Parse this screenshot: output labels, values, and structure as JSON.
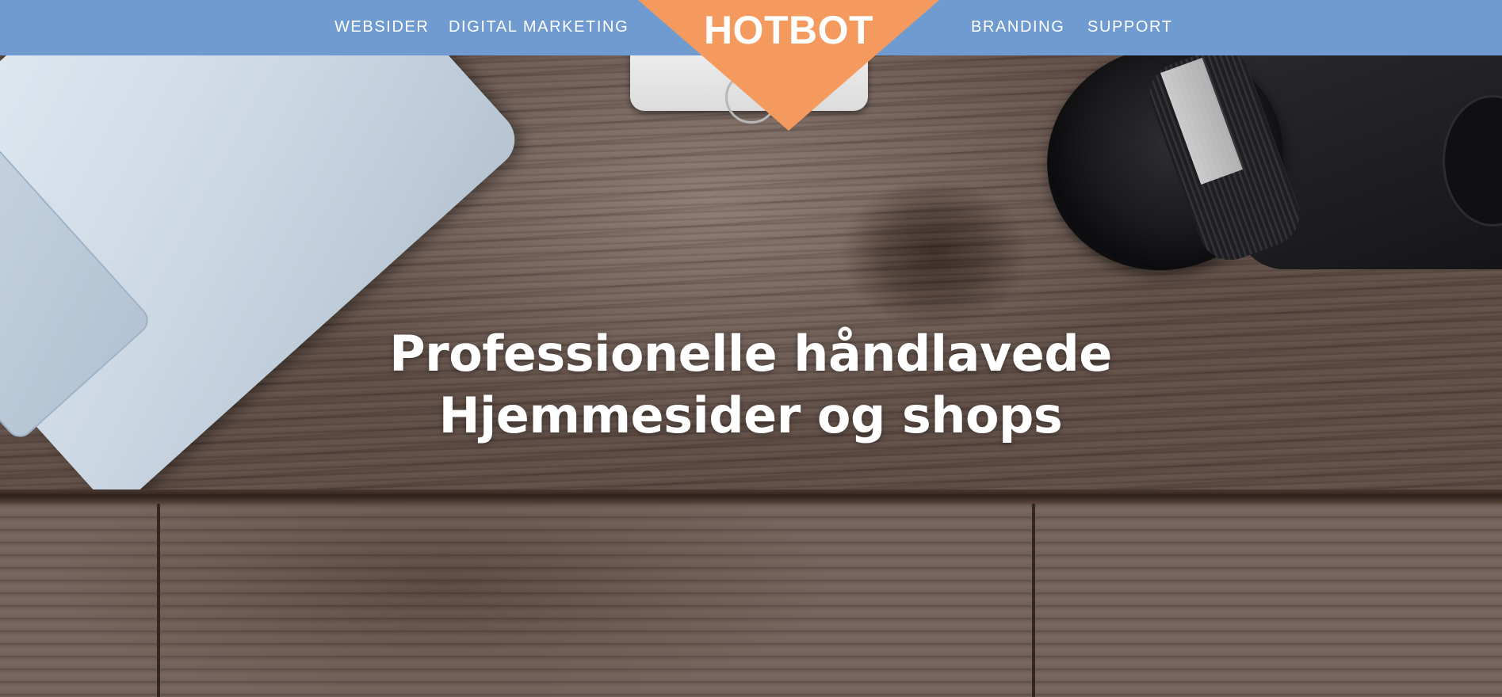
{
  "navbar": {
    "left_links": [
      "WEBSIDER",
      "DIGITAL MARKETING"
    ],
    "right_links": [
      "BRANDING",
      "SUPPORT"
    ],
    "background_color": "#6f9bd1"
  },
  "logo": {
    "text": "HOTBOT",
    "color": "#f59a5e"
  },
  "hero": {
    "headline_line1": "Professionelle håndlavede",
    "headline_line2": "Hjemmesider og shops"
  }
}
